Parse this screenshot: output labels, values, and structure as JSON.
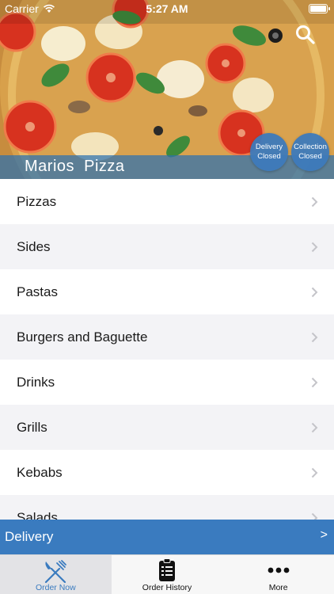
{
  "status_bar": {
    "carrier": "Carrier",
    "time": "5:27 AM"
  },
  "header": {
    "restaurant_name": "Marios  Pizza",
    "search_icon": "search-icon",
    "delivery_status": {
      "line1": "Delivery",
      "line2": "Closed"
    },
    "collection_status": {
      "line1": "Collection",
      "line2": "Closed"
    }
  },
  "menu": {
    "categories": [
      {
        "label": "Pizzas"
      },
      {
        "label": "Sides"
      },
      {
        "label": "Pastas"
      },
      {
        "label": "Burgers and Baguette"
      },
      {
        "label": "Drinks"
      },
      {
        "label": "Grills"
      },
      {
        "label": "Kebabs"
      },
      {
        "label": "Salads"
      }
    ]
  },
  "delivery_bar": {
    "label": "Delivery",
    "arrow": ">"
  },
  "tabs": [
    {
      "label": "Order Now",
      "icon": "fork-knife-icon",
      "active": true
    },
    {
      "label": "Order History",
      "icon": "clipboard-list-icon",
      "active": false
    },
    {
      "label": "More",
      "icon": "more-dots-icon",
      "active": false
    }
  ],
  "colors": {
    "accent": "#3a7bbf",
    "title_strip": "#2b70b0",
    "alt_row": "#f3f3f6"
  }
}
